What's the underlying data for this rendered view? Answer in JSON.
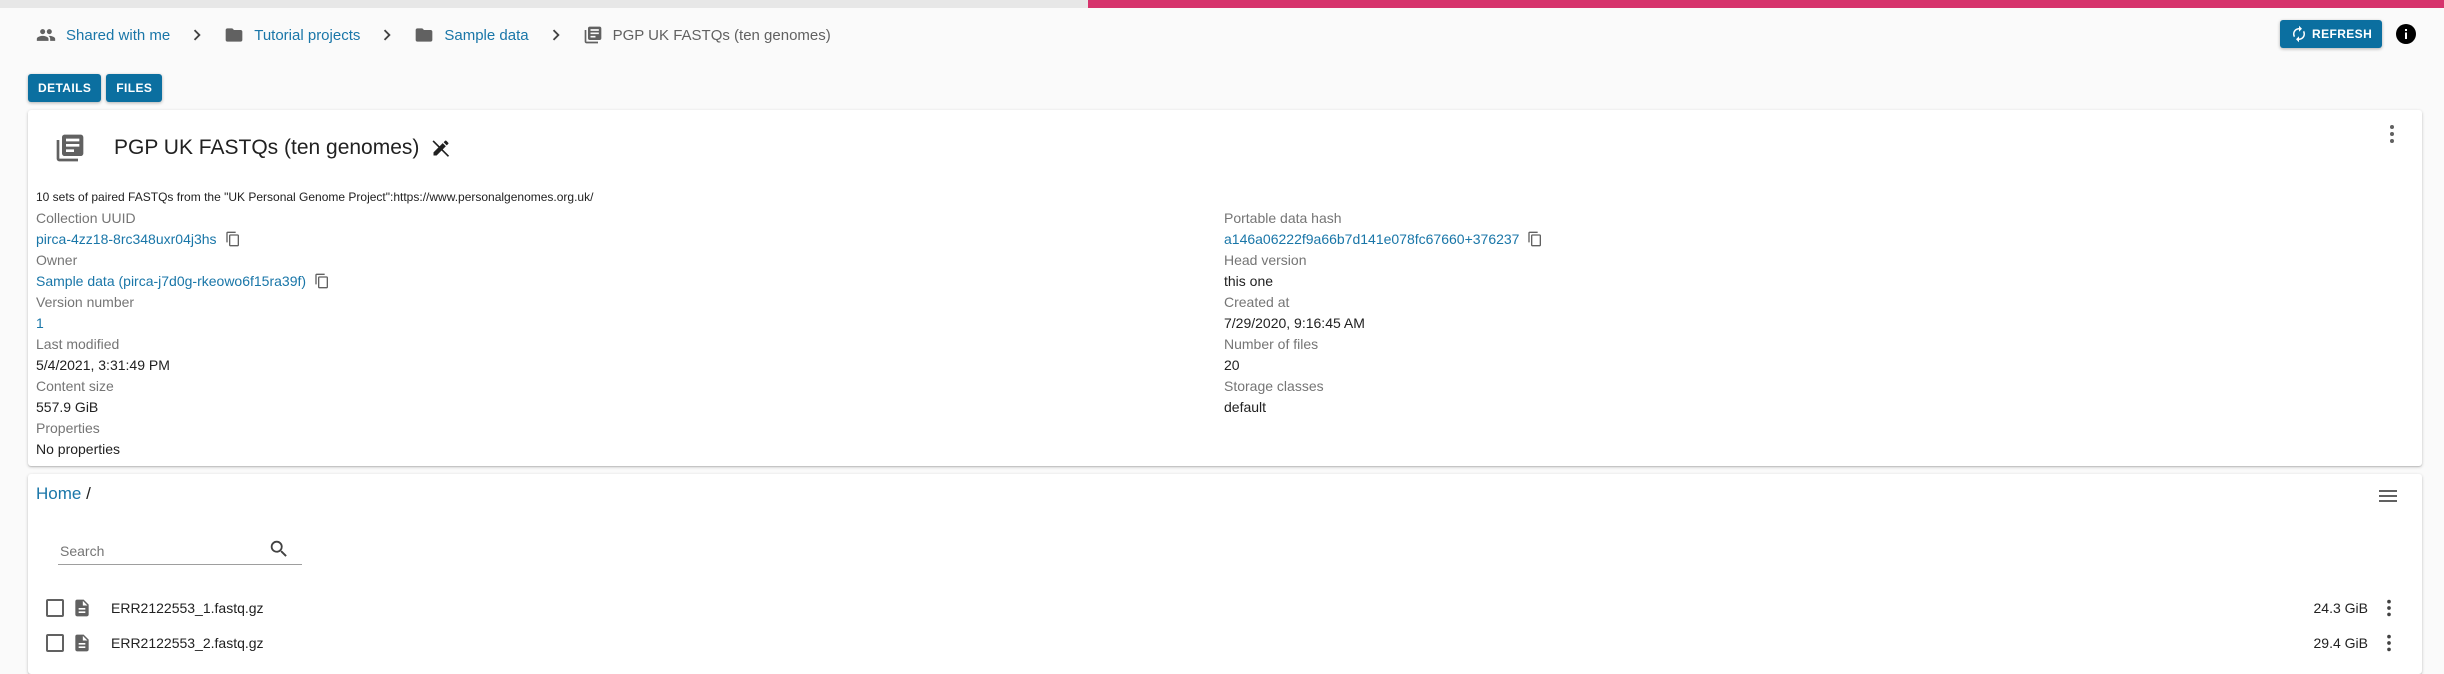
{
  "page_progress": 0.445,
  "colors": {
    "accent": "#0b6fa0",
    "link": "#1976a8",
    "progress": "#c2185b"
  },
  "breadcrumb": [
    {
      "label": "Shared with me",
      "icon": "people-icon"
    },
    {
      "label": "Tutorial projects",
      "icon": "folder-icon"
    },
    {
      "label": "Sample data",
      "icon": "folder-icon"
    },
    {
      "label": "PGP UK FASTQs (ten genomes)",
      "icon": "collection-icon"
    }
  ],
  "toolbar": {
    "refresh_label": "REFRESH"
  },
  "tabs": {
    "details": "DETAILS",
    "files": "FILES"
  },
  "collection": {
    "title": "PGP UK FASTQs (ten genomes)",
    "description": "10 sets of paired FASTQs from the \"UK Personal Genome Project\":https://www.personalgenomes.org.uk/",
    "left_fields": [
      {
        "label": "Collection UUID",
        "value": "pirca-4zz18-8rc348uxr04j3hs"
      },
      {
        "label": "Owner",
        "value": "Sample data (pirca-j7d0g-rkeowo6f15ra39f)"
      },
      {
        "label": "Version number",
        "value": "1"
      },
      {
        "label": "Last modified",
        "value": "5/4/2021, 3:31:49 PM"
      },
      {
        "label": "Content size",
        "value": "557.9 GiB"
      },
      {
        "label": "Properties",
        "value": "No properties"
      }
    ],
    "right_fields": [
      {
        "label": "Portable data hash",
        "value": "a146a06222f9a66b7d141e078fc67660+376237"
      },
      {
        "label": "Head version",
        "value": "this one"
      },
      {
        "label": "Created at",
        "value": "7/29/2020, 9:16:45 AM"
      },
      {
        "label": "Number of files",
        "value": "20"
      },
      {
        "label": "Storage classes",
        "value": "default"
      }
    ]
  },
  "files": {
    "breadcrumb_home": "Home",
    "breadcrumb_sep": "/",
    "search_placeholder": "Search",
    "rows": [
      {
        "name": "ERR2122553_1.fastq.gz",
        "size": "24.3 GiB"
      },
      {
        "name": "ERR2122553_2.fastq.gz",
        "size": "29.4 GiB"
      }
    ]
  }
}
